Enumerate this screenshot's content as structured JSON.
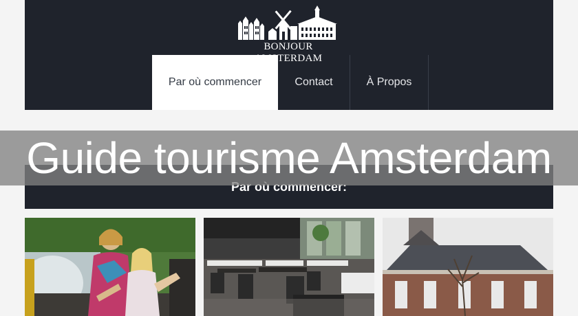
{
  "site": {
    "logo_text": "BONJOUR AMSTERDAM",
    "logo_icon": "amsterdam-canal-houses-windmill-icon"
  },
  "nav": {
    "items": [
      {
        "label": "Par où commencer",
        "active": true
      },
      {
        "label": "Contact",
        "active": false
      },
      {
        "label": "À Propos",
        "active": false
      }
    ]
  },
  "overlay": {
    "title": "Guide tourisme Amsterdam"
  },
  "section": {
    "title": "Par où commencer:"
  },
  "cards": [
    {
      "image": "family-boat-splash-photo"
    },
    {
      "image": "restaurant-interior-photo"
    },
    {
      "image": "church-building-photo"
    }
  ],
  "colors": {
    "header_bg": "#1f232c",
    "page_bg": "#f4f4f4",
    "nav_active_bg": "#ffffff",
    "overlay_bg": "#828282"
  }
}
